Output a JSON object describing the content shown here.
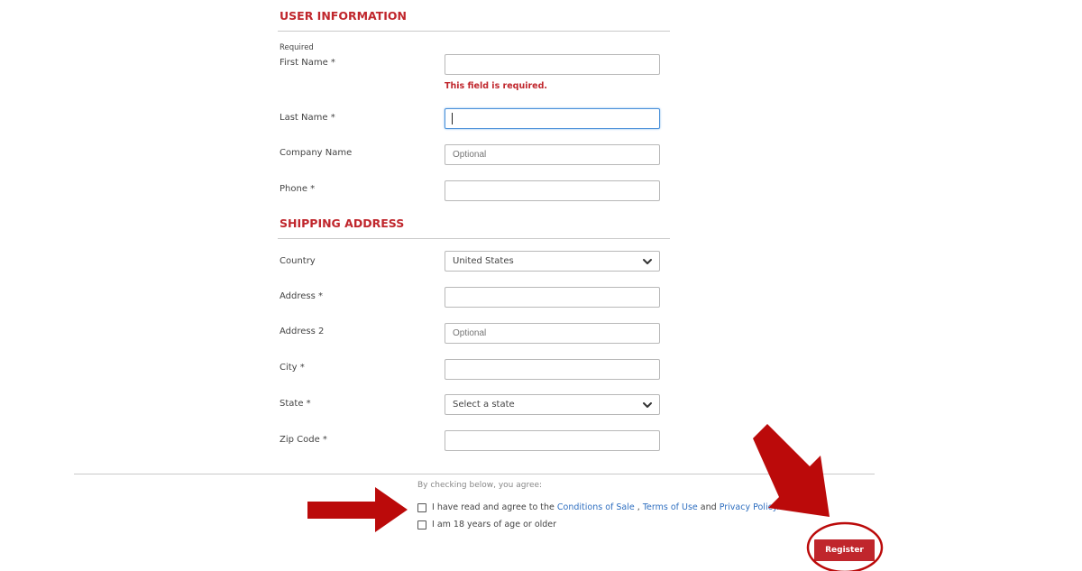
{
  "user_info": {
    "title": "USER INFORMATION",
    "required_note": "Required",
    "first_name": {
      "label": "First Name *",
      "value": "",
      "error": "This field is required."
    },
    "last_name": {
      "label": "Last Name *",
      "value": ""
    },
    "company": {
      "label": "Company Name",
      "placeholder": "Optional"
    },
    "phone": {
      "label": "Phone *",
      "value": ""
    }
  },
  "shipping": {
    "title": "SHIPPING ADDRESS",
    "country": {
      "label": "Country",
      "selected": "United States"
    },
    "address": {
      "label": "Address *",
      "value": ""
    },
    "address2": {
      "label": "Address 2",
      "placeholder": "Optional"
    },
    "city": {
      "label": "City *",
      "value": ""
    },
    "state": {
      "label": "State *",
      "selected": "Select a state"
    },
    "zip": {
      "label": "Zip Code *",
      "value": ""
    }
  },
  "agreement": {
    "intro": "By checking below, you agree:",
    "terms_prefix": "I have read and agree to the",
    "conditions_link": "Conditions of Sale",
    "comma": ",",
    "terms_link": "Terms of Use",
    "and": "and",
    "privacy_link": "Privacy Policy.",
    "age_label": "I am 18 years of age or older",
    "terms_checked": false,
    "age_checked": false
  },
  "register_button": "Register",
  "annotation": {
    "arrow_color": "#bb0a0a",
    "circle_color": "#bb0a0a"
  },
  "colors": {
    "accent": "#c0262c",
    "link": "#2f6fc0",
    "focus": "#4a90d9"
  }
}
